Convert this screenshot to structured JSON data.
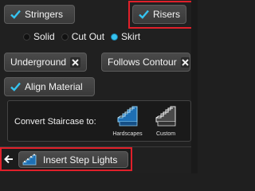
{
  "stringers": {
    "label": "Stringers",
    "checked": true
  },
  "risers": {
    "label": "Risers",
    "checked": true
  },
  "riser_style": {
    "options": [
      "Solid",
      "Cut Out",
      "Skirt"
    ],
    "selected": "Skirt"
  },
  "underground": {
    "label": "Underground"
  },
  "follows_contour": {
    "label": "Follows Contour"
  },
  "align_material": {
    "label": "Align Material",
    "checked": true
  },
  "convert": {
    "label": "Convert Staircase to:",
    "tools": [
      {
        "label": "Hardscapes",
        "icon": "hardscape-stairs-icon"
      },
      {
        "label": "Custom",
        "icon": "custom-stairs-icon"
      }
    ]
  },
  "insert_step_lights": {
    "label": "Insert Step Lights",
    "icon": "step-lights-icon"
  },
  "colors": {
    "accent": "#35c3f0",
    "highlight_frame": "#e0202a"
  }
}
